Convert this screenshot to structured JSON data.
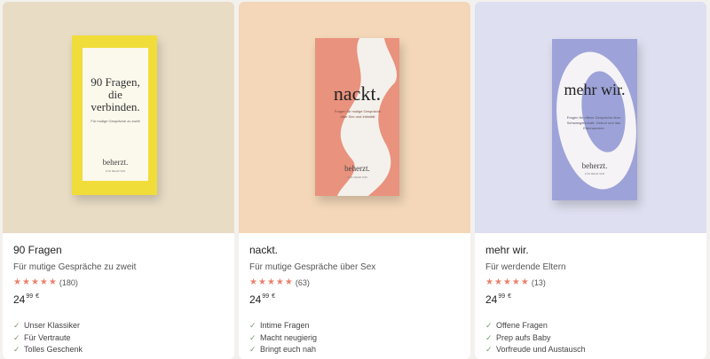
{
  "products": [
    {
      "name": "90 Fragen",
      "tagline": "Für mutige Gespräche zu zweit",
      "rating_count": "(180)",
      "price_main": "24",
      "price_cents": "99",
      "currency": "€",
      "features": [
        "Unser Klassiker",
        "Für Vertraute",
        "Tolles Geschenk"
      ],
      "box_title": "90 Fragen, die verbinden.",
      "box_subtitle": "Für mutige Gespräche zu zweit",
      "box_brand": "beherzt.",
      "box_brand_sub": "FÜR MEHR WIR"
    },
    {
      "name": "nackt.",
      "tagline": "Für mutige Gespräche über Sex",
      "rating_count": "(63)",
      "price_main": "24",
      "price_cents": "99",
      "currency": "€",
      "features": [
        "Intime Fragen",
        "Macht neugierig",
        "Bringt euch nah"
      ],
      "box_title": "nackt.",
      "box_subtitle": "Fragen für mutige Gespräche über Sex und Intimität",
      "box_brand": "beherzt.",
      "box_brand_sub": "FÜR MEHR WIR"
    },
    {
      "name": "mehr wir.",
      "tagline": "Für werdende Eltern",
      "rating_count": "(13)",
      "price_main": "24",
      "price_cents": "99",
      "currency": "€",
      "features": [
        "Offene Fragen",
        "Prep aufs Baby",
        "Vorfreude und Austausch"
      ],
      "box_title": "mehr wir.",
      "box_subtitle": "Fragen für offene Gespräche über Schwangerschaft, Geburt und das Elternwerden",
      "box_brand": "beherzt.",
      "box_brand_sub": "FÜR MEHR WIR"
    }
  ],
  "rating_stars": 5,
  "colors": {
    "star": "#e8826e",
    "check": "#7a9a78",
    "card0_bg": "#e8dcc5",
    "card1_bg": "#f3d7b8",
    "card2_bg": "#dedff0"
  }
}
